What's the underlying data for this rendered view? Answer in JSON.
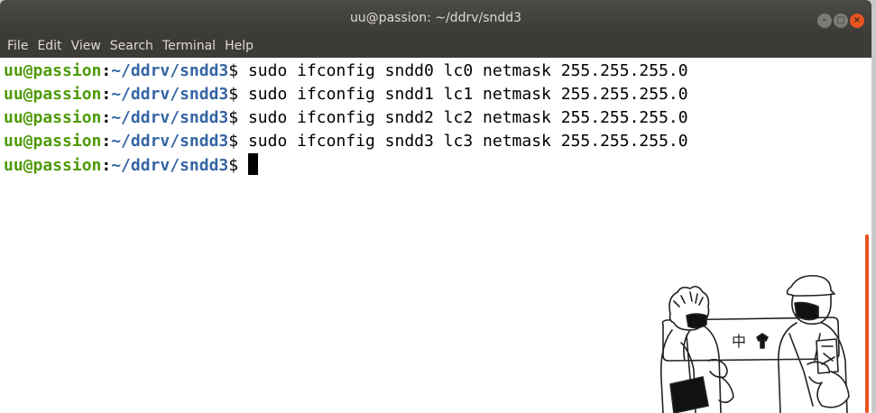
{
  "window": {
    "title": "uu@passion: ~/ddrv/sndd3",
    "buttons": {
      "minimize": "–",
      "maximize": "□",
      "close": "×"
    }
  },
  "menubar": [
    "File",
    "Edit",
    "View",
    "Search",
    "Terminal",
    "Help"
  ],
  "terminal": {
    "prompt_user": "uu@passion",
    "prompt_sep": ":",
    "prompt_path": "~/ddrv/sndd3",
    "prompt_dollar": "$",
    "lines": [
      {
        "command": " sudo ifconfig sndd0 lc0 netmask 255.255.255.0"
      },
      {
        "command": " sudo ifconfig sndd1 lc1 netmask 255.255.255.0"
      },
      {
        "command": " sudo ifconfig sndd2 lc2 netmask 255.255.255.0"
      },
      {
        "command": " sudo ifconfig sndd3 lc3 netmask 255.255.255.0"
      },
      {
        "command": ""
      }
    ]
  },
  "sticker": {
    "sign_text": "中"
  },
  "colors": {
    "prompt_user": "#4e9a06",
    "prompt_path": "#3465a4",
    "accent": "#e95420",
    "titlebar": "#3c3b37"
  },
  "scrollbar": {
    "position_fraction": 0.5,
    "visible_fraction": 0.5
  }
}
